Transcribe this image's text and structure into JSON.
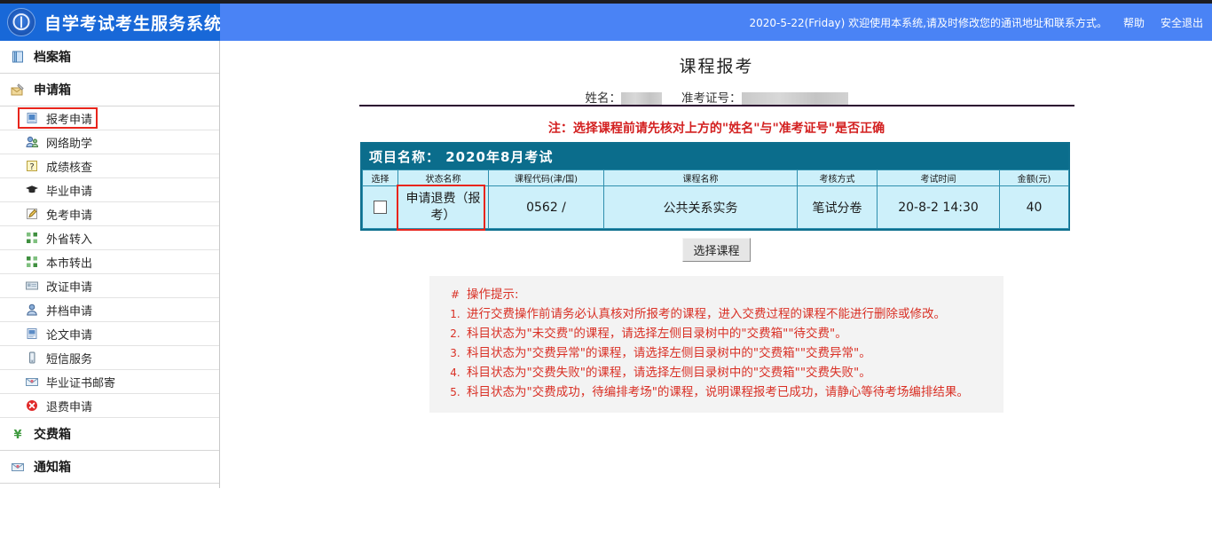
{
  "header": {
    "site_title": "自学考试考生服务系统",
    "message": "2020-5-22(Friday) 欢迎使用本系统,请及时修改您的通讯地址和联系方式。",
    "help_label": "帮助",
    "logout_label": "安全退出"
  },
  "sidebar": {
    "groups": [
      {
        "label": "档案箱",
        "icon": "archive-box-icon"
      },
      {
        "label": "申请箱",
        "icon": "application-box-icon"
      },
      {
        "label": "交费箱",
        "icon": "payment-box-icon"
      },
      {
        "label": "通知箱",
        "icon": "notice-box-icon"
      }
    ],
    "items": [
      {
        "label": "报考申请",
        "icon": "exam-apply-icon",
        "selected": true
      },
      {
        "label": "网络助学",
        "icon": "online-study-icon",
        "selected": false
      },
      {
        "label": "成绩核查",
        "icon": "score-check-icon",
        "selected": false
      },
      {
        "label": "毕业申请",
        "icon": "graduation-cap-icon",
        "selected": false
      },
      {
        "label": "免考申请",
        "icon": "pencil-icon",
        "selected": false
      },
      {
        "label": "外省转入",
        "icon": "transfer-in-icon",
        "selected": false
      },
      {
        "label": "本市转出",
        "icon": "transfer-out-icon",
        "selected": false
      },
      {
        "label": "改证申请",
        "icon": "id-card-icon",
        "selected": false
      },
      {
        "label": "并档申请",
        "icon": "person-icon",
        "selected": false
      },
      {
        "label": "论文申请",
        "icon": "paper-icon",
        "selected": false
      },
      {
        "label": "短信服务",
        "icon": "mobile-icon",
        "selected": false
      },
      {
        "label": "毕业证书邮寄",
        "icon": "mail-icon",
        "selected": false
      },
      {
        "label": "退费申请",
        "icon": "refund-icon",
        "selected": false
      }
    ]
  },
  "main": {
    "page_title": "课程报考",
    "name_label": "姓名：",
    "ticket_label": "准考证号：",
    "name_value": "",
    "ticket_value": "",
    "note": "注：选择课程前请先核对上方的\"姓名\"与\"准考证号\"是否正确",
    "table": {
      "banner_label": "项目名称：",
      "banner_value": "2020年8月考试",
      "columns": [
        "选择",
        "状态名称",
        "课程代码(津/国)",
        "课程名称",
        "考核方式",
        "考试时间",
        "金额(元)"
      ],
      "rows": [
        {
          "selected": false,
          "status": "申请退费（报考）",
          "code": "0562 /",
          "course": "公共关系实务",
          "method": "笔试分卷",
          "time": "20-8-2 14:30",
          "amount": "40"
        }
      ]
    },
    "select_course_button": "选择课程",
    "tips": {
      "head_marker": "#",
      "head_text": "操作提示:",
      "items": [
        {
          "marker": "1.",
          "text": "进行交费操作前请务必认真核对所报考的课程，进入交费过程的课程不能进行删除或修改。"
        },
        {
          "marker": "2.",
          "text": "科目状态为\"未交费\"的课程，请选择左侧目录树中的\"交费箱\"\"待交费\"。"
        },
        {
          "marker": "3.",
          "text": "科目状态为\"交费异常\"的课程，请选择左侧目录树中的\"交费箱\"\"交费异常\"。"
        },
        {
          "marker": "4.",
          "text": "科目状态为\"交费失败\"的课程，请选择左侧目录树中的\"交费箱\"\"交费失败\"。"
        },
        {
          "marker": "5.",
          "text": "科目状态为\"交费成功，待编排考场\"的课程，说明课程报考已成功，请静心等待考场编排结果。"
        }
      ]
    }
  },
  "colors": {
    "header_left_blue": "#1868d8",
    "header_right_blue": "#4a83f5",
    "table_banner": "#0b6d8c",
    "table_cell": "#cdf0fa",
    "highlight_red": "#e8251c",
    "note_red": "#d32020",
    "tips_bg": "#f3f3f3"
  }
}
